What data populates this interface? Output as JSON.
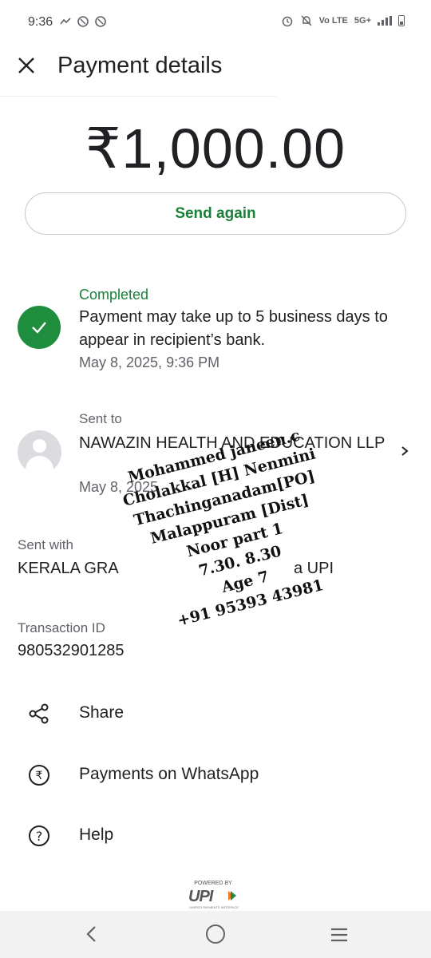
{
  "status_bar": {
    "time": "9:36",
    "network_label": "5G+",
    "volte_label": "Vo LTE"
  },
  "header": {
    "title": "Payment details",
    "close_icon": "close-icon"
  },
  "amount": "₹1,000.00",
  "send_again_label": "Send again",
  "status": {
    "label": "Completed",
    "description": "Payment may take up to 5 business days to appear in recipient’s bank.",
    "date": "May 8, 2025, 9:36 PM",
    "color": "#1e8e3e"
  },
  "recipient": {
    "section_label": "Sent to",
    "name": "NAWAZIN HEALTH AND EDUCATION LLP",
    "date": "May 8, 2025"
  },
  "sent_with": {
    "label": "Sent with",
    "value": "KERALA GRA",
    "suffix": "a UPI"
  },
  "transaction": {
    "label": "Transaction ID",
    "value": "980532901285"
  },
  "actions": [
    {
      "label": "Share",
      "icon": "share-icon"
    },
    {
      "label": "Payments on WhatsApp",
      "icon": "rupee-circle-icon"
    },
    {
      "label": "Help",
      "icon": "help-icon"
    }
  ],
  "handwritten_note": [
    "Mohammed janeen.c",
    "Cholakkal [H] Nenmini",
    "Thachinganadam[PO]",
    "Malappuram [Dist]",
    "Noor part 1",
    "7.30. 8.30",
    "Age 7",
    "+91 95393 43981"
  ],
  "footer": {
    "powered_by": "POWERED BY",
    "upi_logo_text": "UPI",
    "upi_subtext": "UNIFIED PAYMENTS INTERFACE"
  },
  "colors": {
    "accent_green": "#188038",
    "text_primary": "#202124",
    "text_secondary": "#5f6368"
  }
}
